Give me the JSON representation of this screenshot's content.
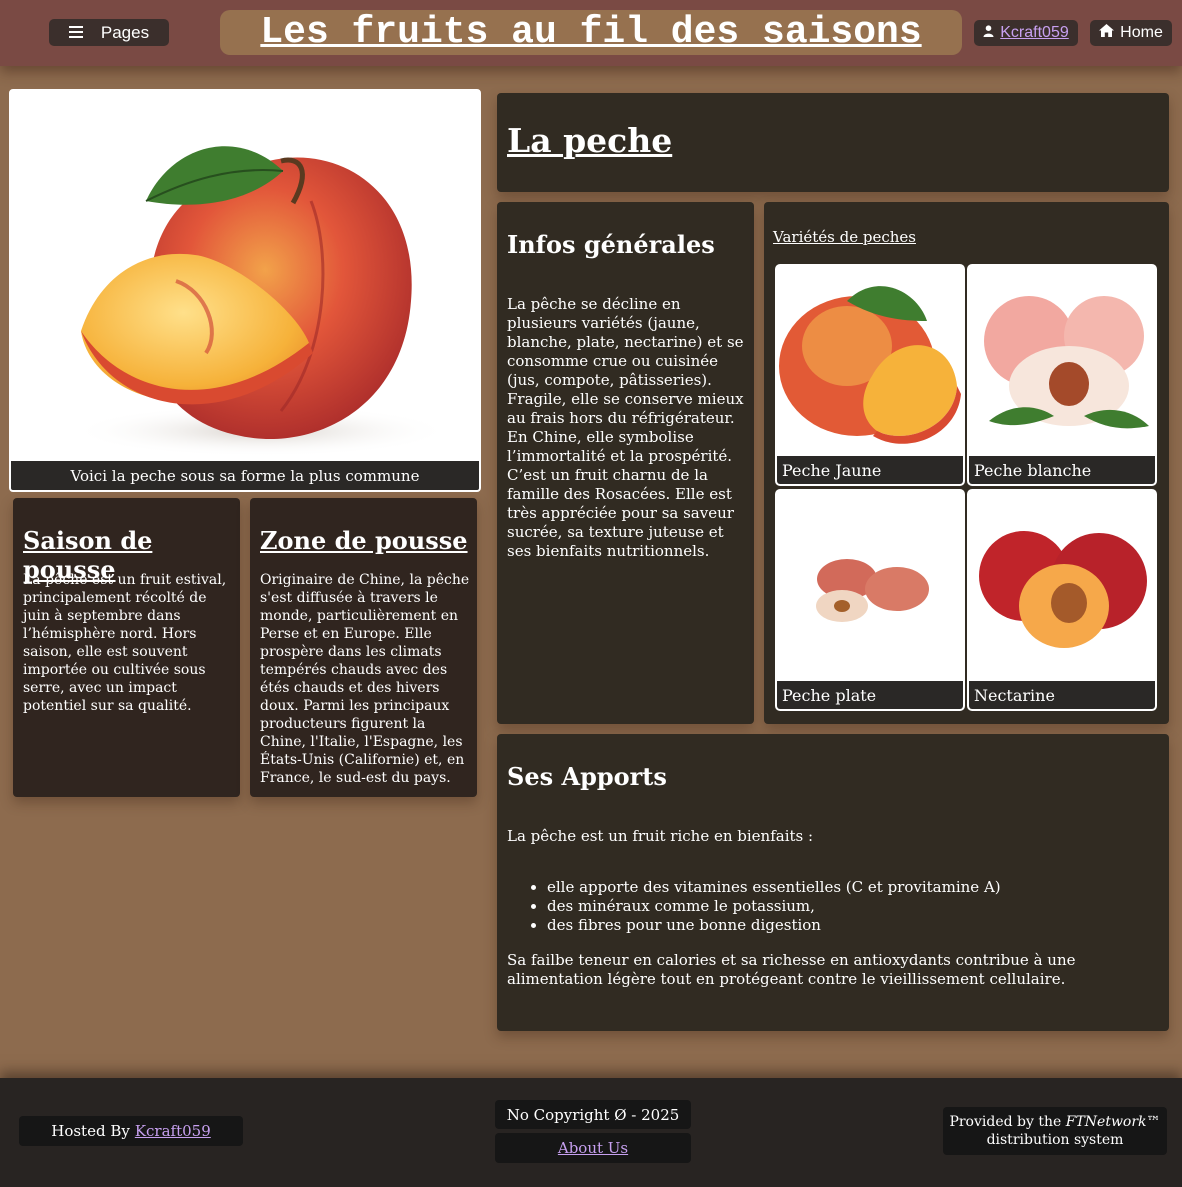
{
  "header": {
    "pages_label": "Pages",
    "title": "Les fruits au fil des saisons",
    "user_label": "Kcraft059",
    "home_label": "Home"
  },
  "main_image": {
    "caption": "Voici la peche sous sa forme la plus commune"
  },
  "fruit": {
    "title": "La peche"
  },
  "saison": {
    "title": "Saison de pousse",
    "text": "La pêche est un fruit estival, principalement récolté de juin à septembre dans l’hémisphère nord. Hors saison, elle est souvent importée ou cultivée sous serre, avec un impact potentiel sur sa qualité."
  },
  "zone": {
    "title": "Zone de pousse",
    "text": "Originaire de Chine, la pêche s'est diffusée à travers le monde, particulièrement en Perse et en Europe. Elle prospère dans les climats tempérés chauds avec des étés chauds et des hivers doux. Parmi les principaux producteurs figurent la Chine, l'Italie, l'Espagne, les États-Unis (Californie) et, en France, le sud-est du pays."
  },
  "infos": {
    "title": "Infos générales",
    "text": "La pêche se décline en plusieurs variétés (jaune, blanche, plate, nectarine) et se consomme crue ou cuisinée (jus, compote, pâtisseries). Fragile, elle se conserve mieux au frais hors du réfrigérateur. En Chine, elle symbolise l’immortalité et la prospérité. C’est un fruit charnu de la famille des Rosacées. Elle est très appréciée pour sa saveur sucrée, sa texture juteuse et ses bienfaits nutritionnels."
  },
  "varietes": {
    "link": "Variétés de peches",
    "items": [
      {
        "label": "Peche Jaune"
      },
      {
        "label": "Peche blanche"
      },
      {
        "label": "Peche plate"
      },
      {
        "label": "Nectarine"
      }
    ]
  },
  "apports": {
    "title": "Ses Apports",
    "intro": "La pêche est un fruit riche en bienfaits :",
    "items": [
      "elle apporte des vitamines essentielles (C et provitamine A)",
      "des minéraux comme le potassium,",
      "des fibres pour une bonne digestion"
    ],
    "outro": "Sa failbe teneur en calories et sa richesse en antioxydants contribue à une alimentation légère tout en protégeant contre le vieillissement cellulaire."
  },
  "footer": {
    "hosted_prefix": "Hosted By",
    "hosted_link": "Kcraft059",
    "copyright": "No Copyright Ø - 2025",
    "about": "About Us",
    "provided_prefix": "Provided by the",
    "provided_brand": "FTNetwork™",
    "provided_suffix": "distribution system"
  },
  "colors": {
    "background": "#8d6b4e",
    "header": "#7a4a44",
    "card": "#312b22",
    "link": "#c7a0f0"
  }
}
